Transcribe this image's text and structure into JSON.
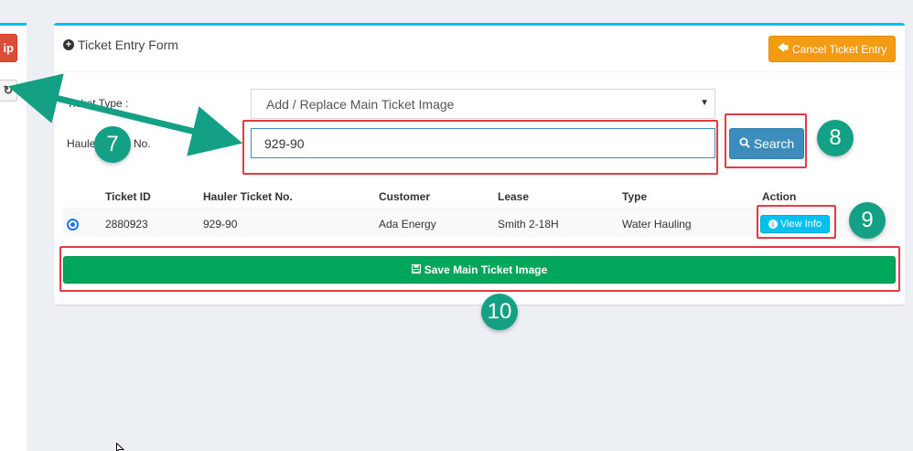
{
  "left_panel": {
    "red_button_label": "ip",
    "refresh_icon": "refresh-icon"
  },
  "form": {
    "title": "Ticket Entry Form",
    "title_icon": "plus-circle-icon",
    "cancel_button_label": "Cancel Ticket Entry",
    "cancel_button_icon": "arrow-left-icon",
    "ticket_type_label": "Ticket Type :",
    "ticket_type_value": "Add / Replace Main Ticket Image",
    "hauler_label_left": "Haule",
    "hauler_label_right": "No.",
    "hauler_input_value": "929-90",
    "search_button_label": "Search",
    "search_icon": "search-icon"
  },
  "table": {
    "headers": [
      "Ticket ID",
      "Hauler Ticket No.",
      "Customer",
      "Lease",
      "Type",
      "Action"
    ],
    "rows": [
      {
        "selected": true,
        "ticket_id": "2880923",
        "hauler_ticket_no": "929-90",
        "customer": "Ada Energy",
        "lease": "Smith 2-18H",
        "type": "Water Hauling",
        "action_label": "View Info"
      }
    ]
  },
  "save_button_label": "Save Main Ticket Image",
  "save_icon": "floppy-disk-icon",
  "annotations": {
    "badge_7": "7",
    "badge_8": "8",
    "badge_9": "9",
    "badge_10": "10",
    "annotation_color": "#e63946",
    "badge_color": "#14a085",
    "arrow_color": "#14a085"
  },
  "colors": {
    "box_top_border": "#00c0ef",
    "cancel_button": "#f39c12",
    "search_button": "#3c8dbc",
    "view_button": "#00c0ef",
    "save_button": "#00a65a",
    "left_red_button": "#dd4b39"
  }
}
